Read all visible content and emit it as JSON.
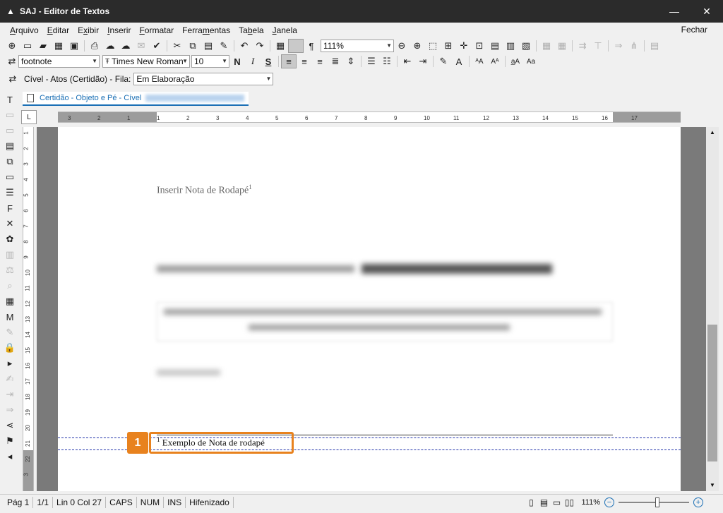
{
  "window": {
    "title": "SAJ - Editor de Textos",
    "minimize_icon": "minimize-icon",
    "close_icon": "close-icon"
  },
  "menu": {
    "items": [
      {
        "label": "Arquivo",
        "u": "A"
      },
      {
        "label": "Editar",
        "u": "E"
      },
      {
        "label": "Exibir",
        "u": "x"
      },
      {
        "label": "Inserir",
        "u": "I"
      },
      {
        "label": "Formatar",
        "u": "F"
      },
      {
        "label": "Ferramentas",
        "u": "m"
      },
      {
        "label": "Tabela",
        "u": "b"
      },
      {
        "label": "Janela",
        "u": "J"
      }
    ],
    "close_doc": "Fechar"
  },
  "toolbar_format": {
    "style_value": "footnote",
    "font_value": "Times New Roman",
    "size_value": "10",
    "bold": "N",
    "italic": "I",
    "strike": "S",
    "zoom_value": "111%"
  },
  "toolbar_queue": {
    "label": "Cível - Atos (Certidão) - Fila:",
    "queue_value": "Em Elaboração"
  },
  "doc_tab": {
    "label": "Certidão - Objeto e Pé - Cível"
  },
  "document": {
    "heading": "Inserir Nota de Rodapé",
    "heading_sup": "1",
    "footnote_sup": "1",
    "footnote_text": "Exemplo de Nota de rodapé",
    "callout_number": "1"
  },
  "ruler": {
    "h_ticks": [
      "3",
      "2",
      "1",
      "1",
      "2",
      "3",
      "4",
      "5",
      "6",
      "7",
      "8",
      "9",
      "10",
      "11",
      "12",
      "13",
      "14",
      "15",
      "16",
      "17"
    ],
    "v_ticks": [
      "1",
      "2",
      "3",
      "4",
      "5",
      "6",
      "7",
      "8",
      "9",
      "10",
      "11",
      "12",
      "13",
      "14",
      "15",
      "16",
      "17",
      "18",
      "19",
      "20",
      "21",
      "22",
      "3"
    ]
  },
  "statusbar": {
    "page": "Pág 1",
    "pages": "1/1",
    "position": "Lin 0  Col 27",
    "caps": "CAPS",
    "num": "NUM",
    "ins": "INS",
    "hyphen": "Hifenizado",
    "zoom": "111%",
    "zoom_level": 0.55
  },
  "colors": {
    "accent": "#e8821e",
    "tab_blue": "#1a6fb5"
  }
}
